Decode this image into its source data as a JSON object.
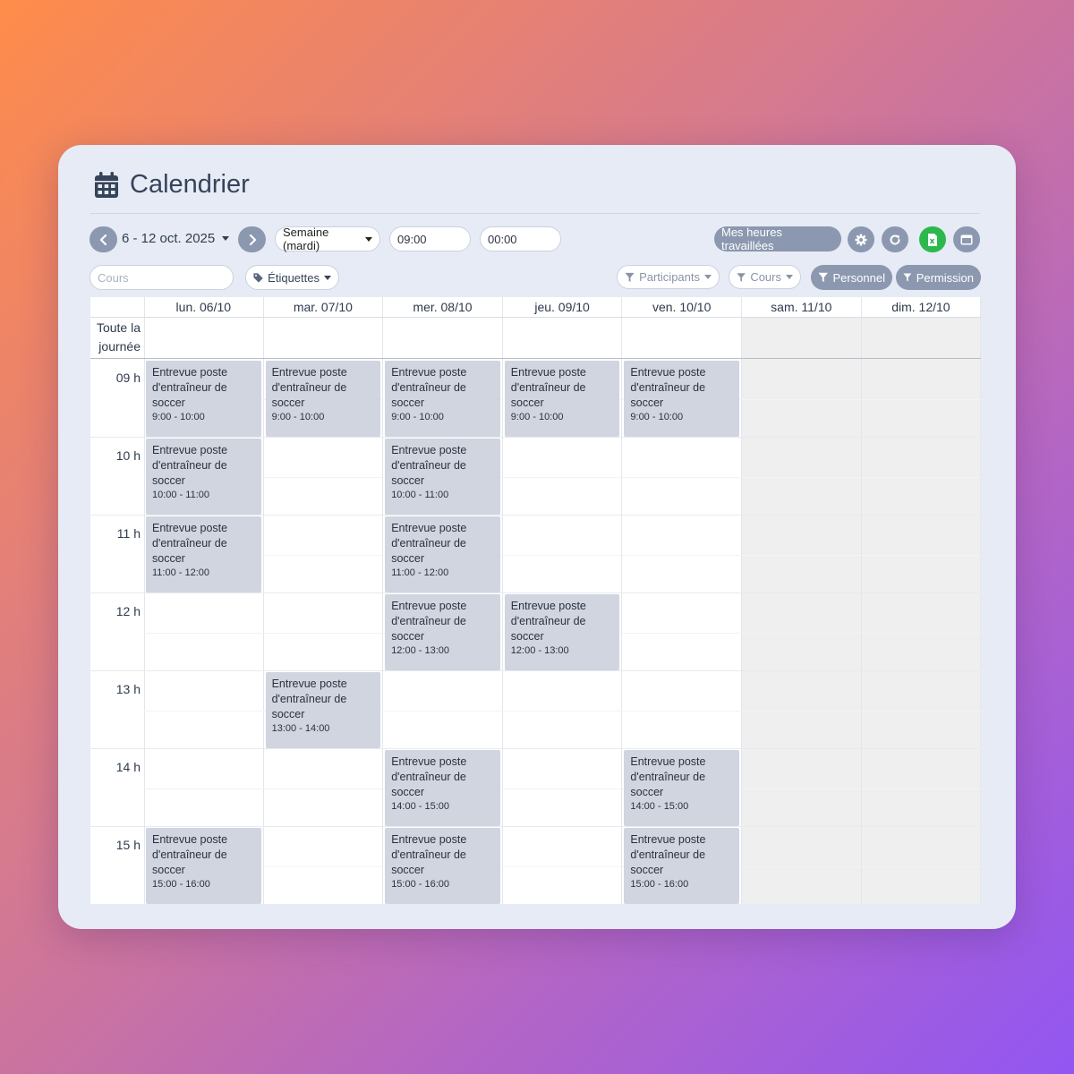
{
  "page": {
    "title": "Calendrier",
    "icon": "calendar-icon"
  },
  "toolbar": {
    "date_range": "6 - 12 oct. 2025",
    "view_select": "Semaine (mardi)",
    "start_time": "09:00",
    "end_time": "00:00",
    "hours_worked_button": "Mes heures travaillées",
    "course_search_placeholder": "Cours",
    "tags_dropdown": "Étiquettes",
    "filter_participants": "Participants",
    "filter_courses": "Cours",
    "filter_staff": "Personnel",
    "filter_permission": "Permission",
    "export_color": "#2db84d"
  },
  "calendar": {
    "all_day_label": "Toute la journée",
    "days": [
      "lun. 06/10",
      "mar. 07/10",
      "mer. 08/10",
      "jeu. 09/10",
      "ven. 10/10",
      "sam. 11/10",
      "dim. 12/10"
    ],
    "hours": [
      "09 h",
      "10 h",
      "11 h",
      "12 h",
      "13 h",
      "14 h",
      "15 h"
    ],
    "event_title": "Entrevue poste d'entraîneur de soccer",
    "events": [
      {
        "day": 0,
        "start": 9,
        "time": "9:00 - 10:00"
      },
      {
        "day": 1,
        "start": 9,
        "time": "9:00 - 10:00"
      },
      {
        "day": 2,
        "start": 9,
        "time": "9:00 - 10:00"
      },
      {
        "day": 3,
        "start": 9,
        "time": "9:00 - 10:00"
      },
      {
        "day": 4,
        "start": 9,
        "time": "9:00 - 10:00"
      },
      {
        "day": 0,
        "start": 10,
        "time": "10:00 - 11:00"
      },
      {
        "day": 2,
        "start": 10,
        "time": "10:00 - 11:00"
      },
      {
        "day": 0,
        "start": 11,
        "time": "11:00 - 12:00"
      },
      {
        "day": 2,
        "start": 11,
        "time": "11:00 - 12:00"
      },
      {
        "day": 2,
        "start": 12,
        "time": "12:00 - 13:00"
      },
      {
        "day": 3,
        "start": 12,
        "time": "12:00 - 13:00"
      },
      {
        "day": 1,
        "start": 13,
        "time": "13:00 - 14:00"
      },
      {
        "day": 2,
        "start": 14,
        "time": "14:00 - 15:00"
      },
      {
        "day": 4,
        "start": 14,
        "time": "14:00 - 15:00"
      },
      {
        "day": 0,
        "start": 15,
        "time": "15:00 - 16:00"
      },
      {
        "day": 2,
        "start": 15,
        "time": "15:00 - 16:00"
      },
      {
        "day": 4,
        "start": 15,
        "time": "15:00 - 16:00"
      }
    ]
  }
}
